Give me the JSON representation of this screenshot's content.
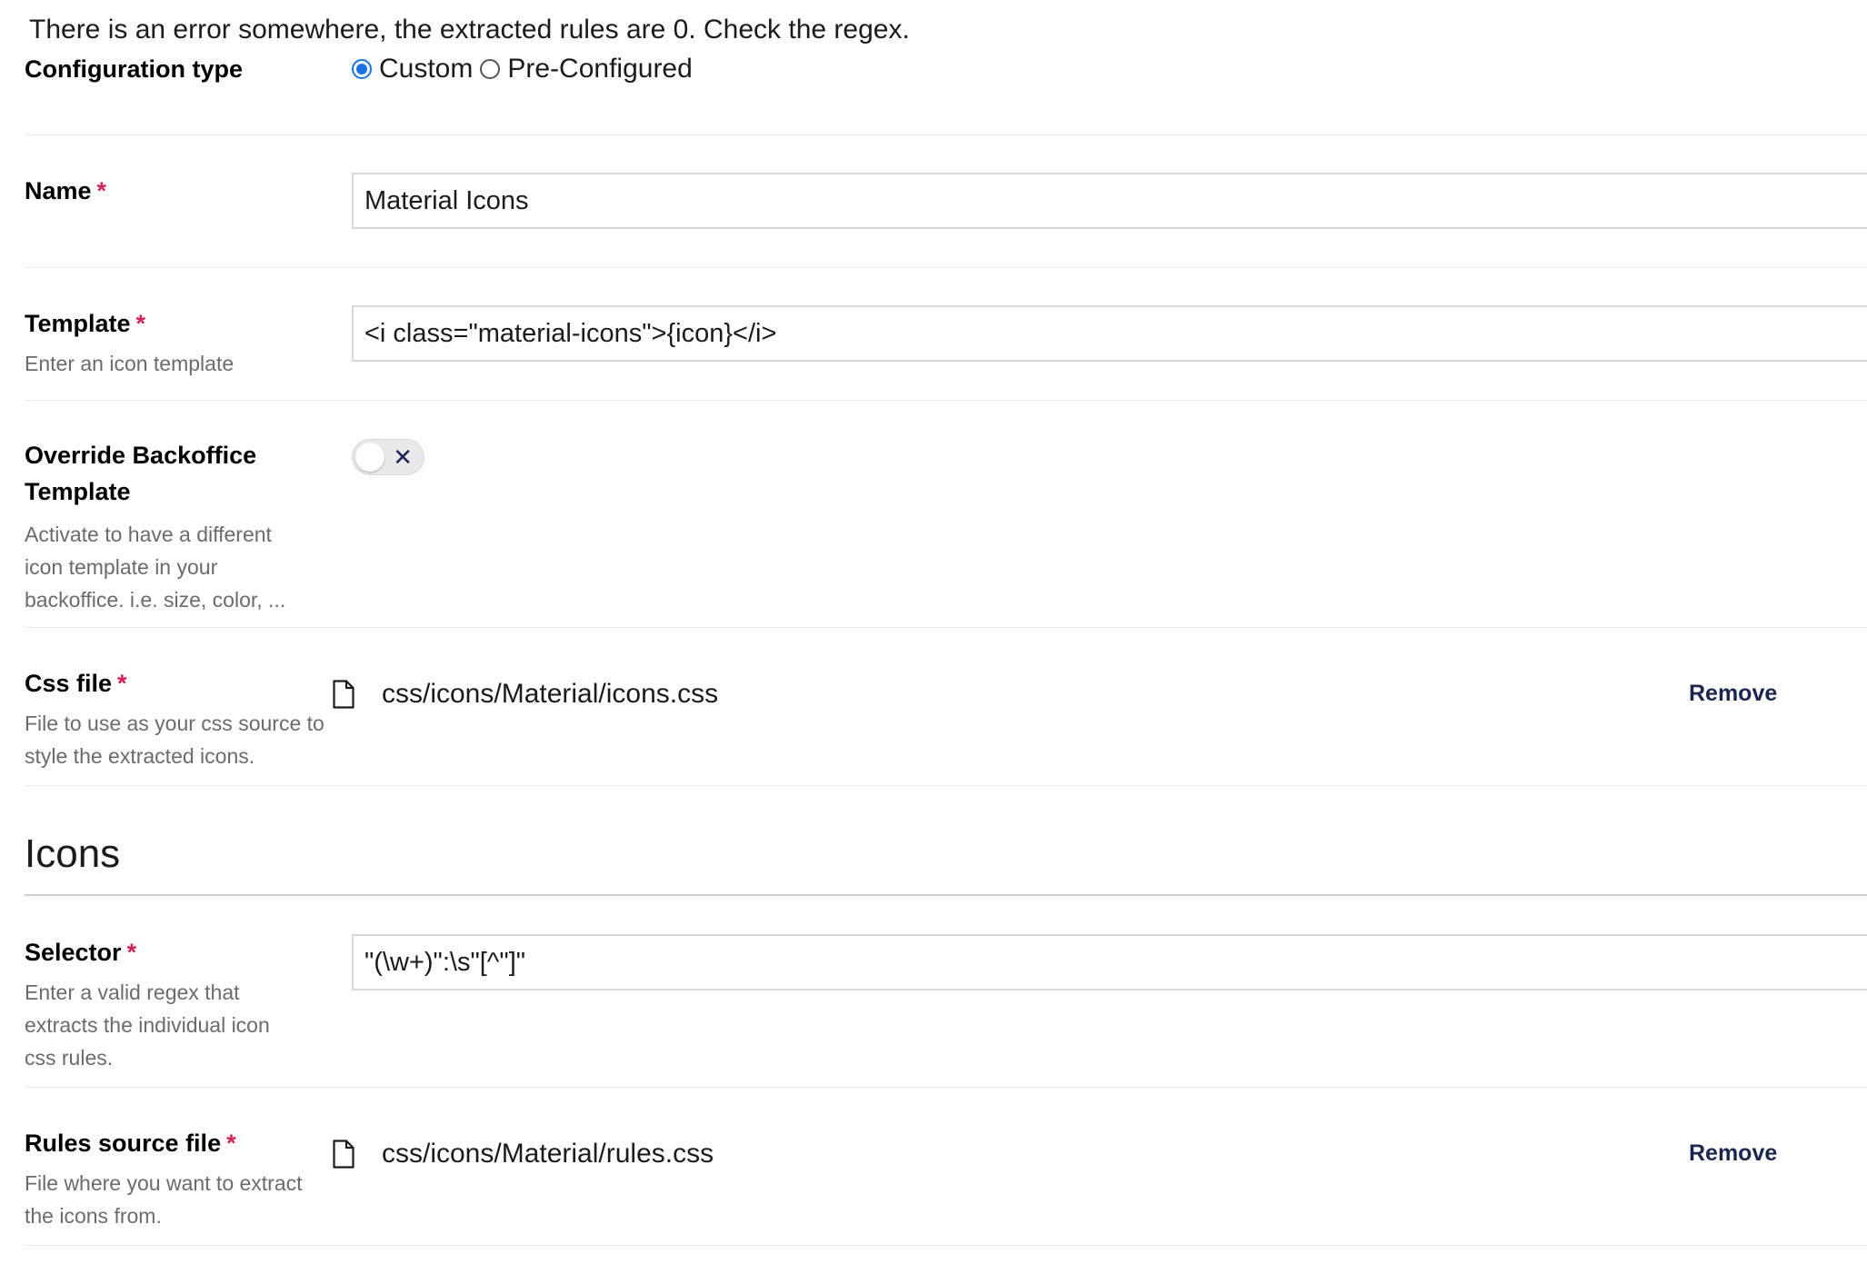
{
  "error_message": "There is an error somewhere, the extracted rules are 0. Check the regex.",
  "configuration_type": {
    "label": "Configuration type",
    "options": [
      {
        "label": "Custom",
        "checked": true
      },
      {
        "label": "Pre-Configured",
        "checked": false
      }
    ]
  },
  "name_field": {
    "label": "Name",
    "required_mark": "*",
    "value": "Material Icons"
  },
  "template_field": {
    "label": "Template",
    "required_mark": "*",
    "description": "Enter an icon template",
    "value": "<i class=\"material-icons\">{icon}</i>"
  },
  "override_field": {
    "label_line1": "Override Backoffice",
    "label_line2": "Template",
    "description": "Activate to have a different icon template in your backoffice. i.e. size, color, ...",
    "toggle_on": false,
    "toggle_glyph": "✕"
  },
  "css_file_field": {
    "label": "Css file",
    "required_mark": "*",
    "description": "File to use as your css source to style the extracted icons.",
    "file_name": "css/icons/Material/icons.css",
    "remove_label": "Remove"
  },
  "icons_section": {
    "title": "Icons"
  },
  "selector_field": {
    "label": "Selector",
    "required_mark": "*",
    "description": "Enter a valid regex that extracts the individual icon css rules.",
    "value": " \"(\\w+)\":\\s\"[^\"]\""
  },
  "rules_file_field": {
    "label": "Rules source file",
    "required_mark": "*",
    "description": "File where you want to extract the icons from.",
    "file_name": "css/icons/Material/rules.css",
    "remove_label": "Remove"
  },
  "colors": {
    "accent": "#1a73e8",
    "required": "#d42054",
    "text": "#1b264f",
    "muted": "#6b6b6b"
  }
}
